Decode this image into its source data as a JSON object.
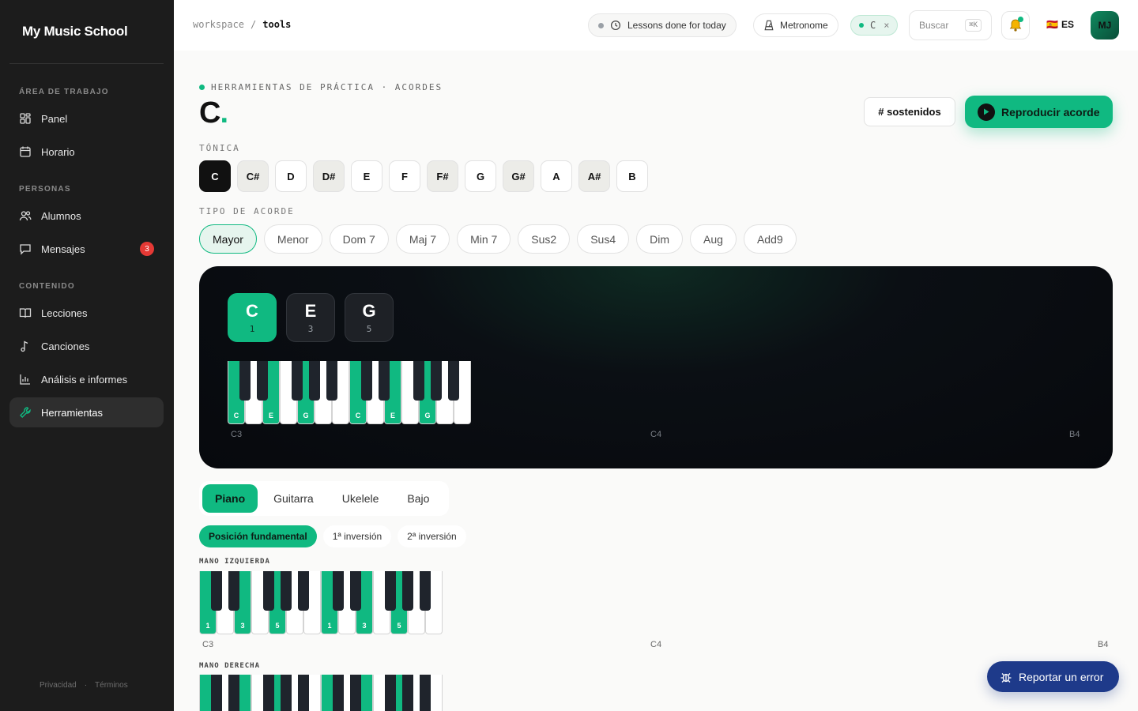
{
  "brand": "My Music School",
  "sidebar": {
    "sections": [
      {
        "label": "ÁREA DE TRABAJO"
      },
      {
        "label": "PERSONAS"
      },
      {
        "label": "CONTENIDO"
      }
    ],
    "items": [
      {
        "label": "Panel",
        "icon": "dashboard-icon"
      },
      {
        "label": "Horario",
        "icon": "calendar-icon"
      },
      {
        "label": "Alumnos",
        "icon": "users-icon"
      },
      {
        "label": "Mensajes",
        "icon": "message-icon",
        "badge": "3"
      },
      {
        "label": "Lecciones",
        "icon": "book-icon"
      },
      {
        "label": "Canciones",
        "icon": "music-note-icon"
      },
      {
        "label": "Análisis e informes",
        "icon": "bar-chart-icon"
      },
      {
        "label": "Herramientas",
        "icon": "wrench-icon",
        "active": true
      }
    ],
    "footer": {
      "privacy": "Privacidad",
      "sep": "·",
      "terms": "Términos"
    }
  },
  "topbar": {
    "breadcrumb": {
      "root": "workspace",
      "sep": "/",
      "current": "tools"
    },
    "lessons": "Lessons done for today",
    "metronome": "Metronome",
    "key_chip": "C",
    "key_close": "×",
    "search_placeholder": "Buscar",
    "search_shortcut": "⌘K",
    "lang": "ES",
    "lang_flag": "🇪🇸",
    "avatar": "MJ"
  },
  "main": {
    "eyebrow": "HERRAMIENTAS DE PRÁCTICA · ACORDES",
    "title": "C",
    "title_dot": ".",
    "sharps_button": "# sostenidos",
    "play_button": "Reproducir acorde",
    "root_label": "TÓNICA",
    "roots": [
      {
        "label": "C",
        "active": true
      },
      {
        "label": "C#",
        "sharp": true
      },
      {
        "label": "D"
      },
      {
        "label": "D#",
        "sharp": true
      },
      {
        "label": "E"
      },
      {
        "label": "F"
      },
      {
        "label": "F#",
        "sharp": true
      },
      {
        "label": "G"
      },
      {
        "label": "G#",
        "sharp": true
      },
      {
        "label": "A"
      },
      {
        "label": "A#",
        "sharp": true
      },
      {
        "label": "B"
      }
    ],
    "type_label": "TIPO DE ACORDE",
    "chord_types": [
      {
        "label": "Mayor",
        "active": true
      },
      {
        "label": "Menor"
      },
      {
        "label": "Dom 7"
      },
      {
        "label": "Maj 7"
      },
      {
        "label": "Min 7"
      },
      {
        "label": "Sus2"
      },
      {
        "label": "Sus4"
      },
      {
        "label": "Dim"
      },
      {
        "label": "Aug"
      },
      {
        "label": "Add9"
      }
    ],
    "chord_notes": [
      {
        "note": "C",
        "degree": "1",
        "root": true
      },
      {
        "note": "E",
        "degree": "3"
      },
      {
        "note": "G",
        "degree": "5"
      }
    ],
    "panel_octaves": [
      "C3",
      "C4",
      "B4"
    ],
    "instruments": [
      {
        "label": "Piano",
        "active": true
      },
      {
        "label": "Guitarra"
      },
      {
        "label": "Ukelele"
      },
      {
        "label": "Bajo"
      }
    ],
    "inversions": [
      {
        "label": "Posición fundamental",
        "active": true
      },
      {
        "label": "1ª inversión"
      },
      {
        "label": "2ª inversión"
      }
    ],
    "left_hand_label": "MANO IZQUIERDA",
    "right_hand_label": "MANO DERECHA",
    "hand_octaves": [
      "C3",
      "C4",
      "B4"
    ],
    "keyboard": {
      "white_keys": [
        "C",
        "D",
        "E",
        "F",
        "G",
        "A",
        "B",
        "C",
        "D",
        "E",
        "F",
        "G",
        "A",
        "B"
      ],
      "highlight_whites": [
        0,
        2,
        4,
        7,
        9,
        11
      ],
      "panel_labels": [
        "C",
        "",
        "E",
        "",
        "G",
        "",
        "",
        "C",
        "",
        "E",
        "",
        "G",
        "",
        ""
      ],
      "finger_labels": [
        "1",
        "",
        "3",
        "",
        "5",
        "",
        "",
        "1",
        "",
        "3",
        "",
        "5",
        "",
        ""
      ]
    },
    "report_button": "Reportar un error"
  },
  "colors": {
    "accent": "#10b981",
    "sidebar": "#1c1c1c",
    "danger": "#e53935",
    "report": "#1e3a8a"
  }
}
